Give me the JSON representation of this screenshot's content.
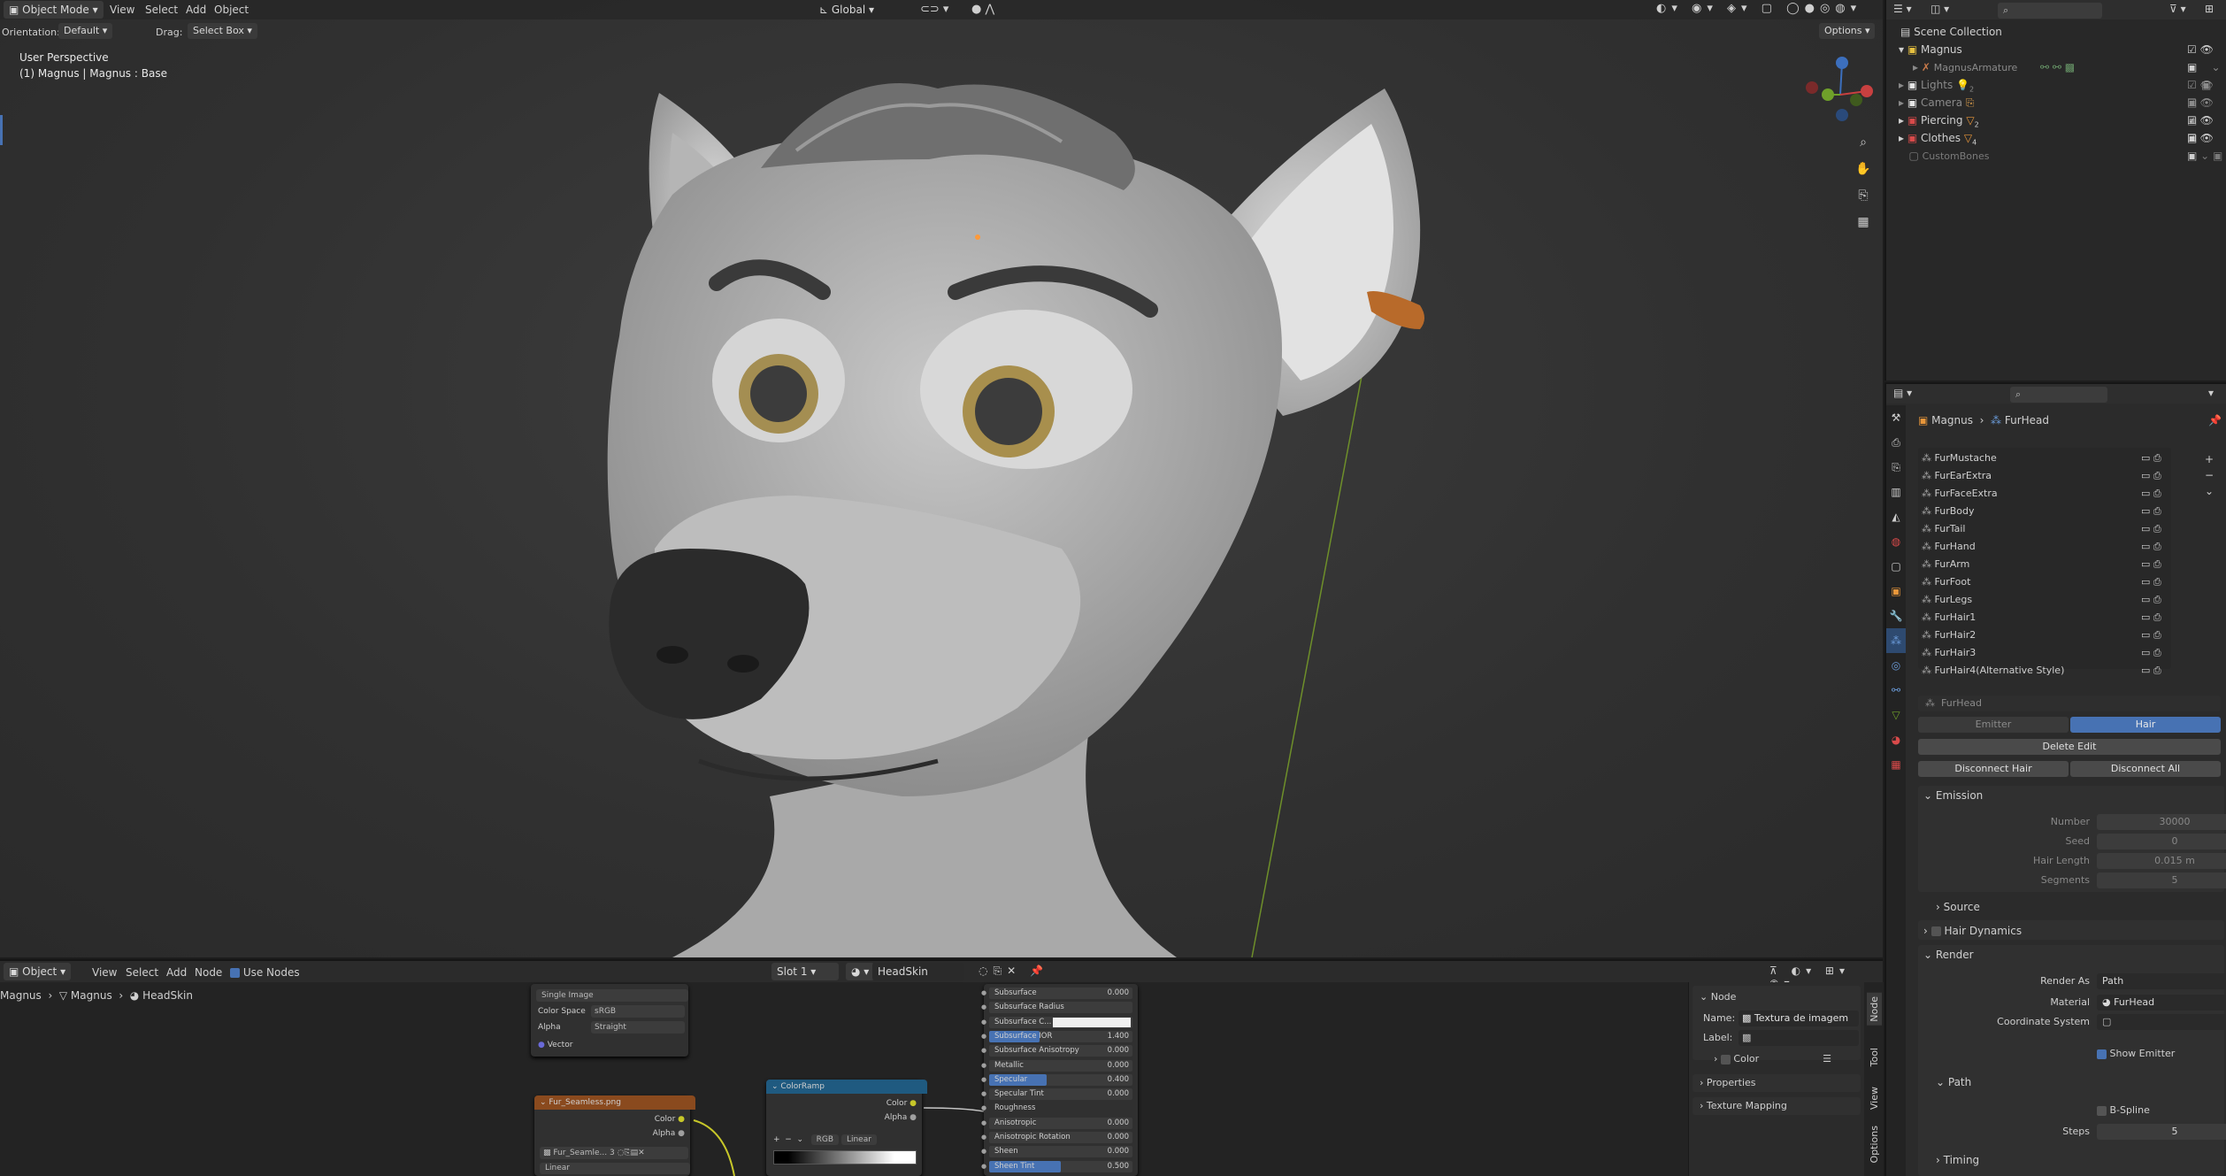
{
  "viewport": {
    "mode": "Object Mode",
    "menus": [
      "View",
      "Select",
      "Add",
      "Object"
    ],
    "transform": "Global",
    "orientation_label": "Orientation:",
    "orientation_value": "Default",
    "drag_label": "Drag:",
    "drag_value": "Select Box",
    "options": "Options",
    "perspective": "User Perspective",
    "object_info": "(1) Magnus | Magnus : Base"
  },
  "outliner": {
    "root": "Scene Collection",
    "items": [
      {
        "label": "Magnus",
        "sub": ""
      },
      {
        "label": "MagnusArmature",
        "sub": ""
      },
      {
        "label": "Lights",
        "sub": "2"
      },
      {
        "label": "Camera",
        "sub": ""
      },
      {
        "label": "Piercing",
        "sub": "2"
      },
      {
        "label": "Clothes",
        "sub": "4"
      },
      {
        "label": "CustomBones",
        "sub": ""
      }
    ]
  },
  "properties": {
    "breadcrumb_object": "Magnus",
    "breadcrumb_system": "FurHead",
    "particle_list": [
      "FurMustache",
      "FurEarExtra",
      "FurFaceExtra",
      "FurBody",
      "FurTail",
      "FurHand",
      "FurArm",
      "FurFoot",
      "FurLegs",
      "FurHair1",
      "FurHair2",
      "FurHair3",
      "FurHair4(Alternative Style)"
    ],
    "settings_name": "FurHead",
    "type_emitter": "Emitter",
    "type_hair": "Hair",
    "delete_edit": "Delete Edit",
    "disconnect_hair": "Disconnect Hair",
    "disconnect_all": "Disconnect All",
    "emission": "Emission",
    "number_label": "Number",
    "number_value": "30000",
    "seed_label": "Seed",
    "seed_value": "0",
    "hair_length_label": "Hair Length",
    "hair_length_value": "0.015 m",
    "segments_label": "Segments",
    "segments_value": "5",
    "source": "Source",
    "hair_dynamics": "Hair Dynamics",
    "render": "Render",
    "render_as_label": "Render As",
    "render_as_value": "Path",
    "material_label": "Material",
    "material_value": "FurHead",
    "coord_label": "Coordinate System",
    "show_emitter": "Show Emitter",
    "path": "Path",
    "bspline": "B-Spline",
    "steps_label": "Steps",
    "steps_value": "5",
    "timing": "Timing"
  },
  "node_editor": {
    "mode": "Object",
    "menus": [
      "View",
      "Select",
      "Add",
      "Node"
    ],
    "use_nodes": "Use Nodes",
    "slot": "Slot 1",
    "material": "HeadSkin",
    "breadcrumb": [
      "Magnus",
      "Magnus",
      "HeadSkin"
    ],
    "sidebar": {
      "node_title": "Node",
      "name_label": "Name:",
      "name_value": "Textura de imagem",
      "label_label": "Label:",
      "color": "Color",
      "properties": "Properties",
      "texture_mapping": "Texture Mapping",
      "tabs": [
        "Node",
        "Tool",
        "View",
        "Options"
      ]
    },
    "image_node": {
      "projection": "Single Image",
      "color_space_label": "Color Space",
      "color_space_value": "sRGB",
      "alpha_label": "Alpha",
      "alpha_value": "Straight",
      "vector": "Vector"
    },
    "fur_node": {
      "title": "Fur_Seamless.png",
      "color": "Color",
      "alpha": "Alpha",
      "image": "Fur_Seamle...",
      "users": "3",
      "interp": "Linear"
    },
    "ramp_node": {
      "title": "ColorRamp",
      "color": "Color",
      "alpha": "Alpha",
      "mode": "RGB",
      "interp": "Linear"
    },
    "bsdf_rows": [
      {
        "label": "Subsurface",
        "value": "0.000",
        "fill": 0
      },
      {
        "label": "Subsurface Radius",
        "value": "",
        "fill": 0
      },
      {
        "label": "Subsurface C...",
        "value": "",
        "fill": 0
      },
      {
        "label": "Subsurface IOR",
        "value": "1.400",
        "fill": 0.35
      },
      {
        "label": "Subsurface Anisotropy",
        "value": "0.000",
        "fill": 0
      },
      {
        "label": "Metallic",
        "value": "0.000",
        "fill": 0
      },
      {
        "label": "Specular",
        "value": "0.400",
        "fill": 0.4
      },
      {
        "label": "Specular Tint",
        "value": "0.000",
        "fill": 0
      },
      {
        "label": "Roughness",
        "value": "",
        "fill": 0
      },
      {
        "label": "Anisotropic",
        "value": "0.000",
        "fill": 0
      },
      {
        "label": "Anisotropic Rotation",
        "value": "0.000",
        "fill": 0
      },
      {
        "label": "Sheen",
        "value": "0.000",
        "fill": 0
      },
      {
        "label": "Sheen Tint",
        "value": "0.500",
        "fill": 0.5
      }
    ]
  },
  "colors": {
    "accent": "#4772b3",
    "image_node_header": "#8a4a1e",
    "ramp_header": "#1f5a80",
    "bg": "#303030"
  }
}
